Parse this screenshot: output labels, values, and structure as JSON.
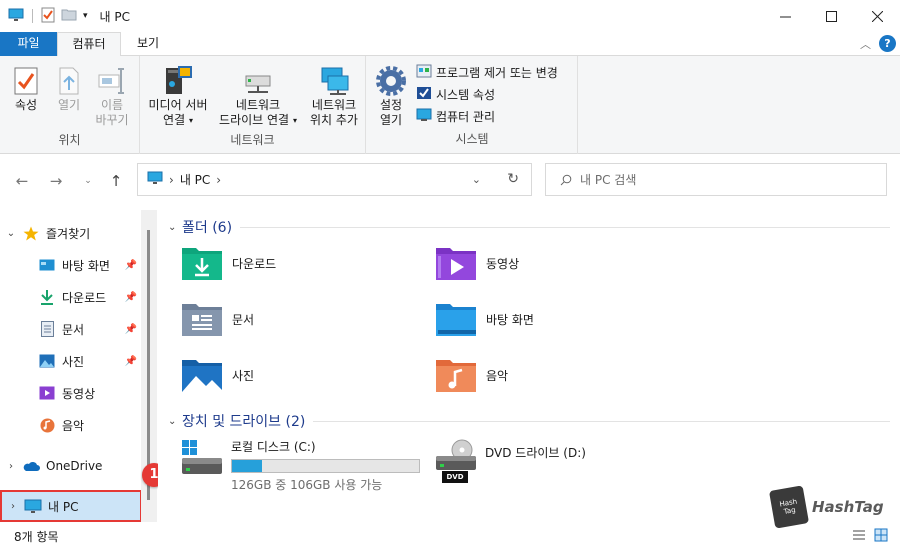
{
  "window": {
    "title": "내 PC"
  },
  "tabs": {
    "file": "파일",
    "computer": "컴퓨터",
    "view": "보기"
  },
  "ribbon": {
    "location": {
      "label": "위치",
      "properties": "속성",
      "open": "열기",
      "rename_line1": "이름",
      "rename_line2": "바꾸기"
    },
    "network": {
      "label": "네트워크",
      "media_line1": "미디어 서버",
      "media_line2": "연결",
      "map_line1": "네트워크",
      "map_line2": "드라이브 연결",
      "add_line1": "네트워크",
      "add_line2": "위치 추가"
    },
    "system": {
      "label": "시스템",
      "settings_line1": "설정",
      "settings_line2": "열기",
      "uninstall": "프로그램 제거 또는 변경",
      "sys_props": "시스템 속성",
      "manage": "컴퓨터 관리"
    }
  },
  "address": {
    "crumb": "내 PC"
  },
  "search": {
    "placeholder": "내 PC 검색"
  },
  "nav": {
    "quick_access": "즐겨찾기",
    "desktop": "바탕 화면",
    "downloads": "다운로드",
    "documents": "문서",
    "pictures": "사진",
    "videos": "동영상",
    "music": "음악",
    "onedrive": "OneDrive",
    "this_pc": "내 PC"
  },
  "callout": "1",
  "content": {
    "folders_title": "폴더 (6)",
    "folders": [
      {
        "name": "다운로드",
        "icon": "downloads-folder-icon"
      },
      {
        "name": "동영상",
        "icon": "videos-folder-icon"
      },
      {
        "name": "문서",
        "icon": "documents-folder-icon"
      },
      {
        "name": "바탕 화면",
        "icon": "desktop-folder-icon"
      },
      {
        "name": "사진",
        "icon": "pictures-folder-icon"
      },
      {
        "name": "음악",
        "icon": "music-folder-icon"
      }
    ],
    "drives_title": "장치 및 드라이브 (2)",
    "local_disk": {
      "name": "로컬 디스크 (C:)",
      "space": "126GB 중 106GB 사용 가능",
      "used_fraction": 0.16
    },
    "dvd": {
      "name": "DVD 드라이브 (D:)",
      "label": "DVD"
    }
  },
  "status": {
    "items": "8개 항목"
  },
  "watermark": {
    "cube_line1": "Hash",
    "cube_line2": "Tag",
    "text": "HashTag"
  }
}
